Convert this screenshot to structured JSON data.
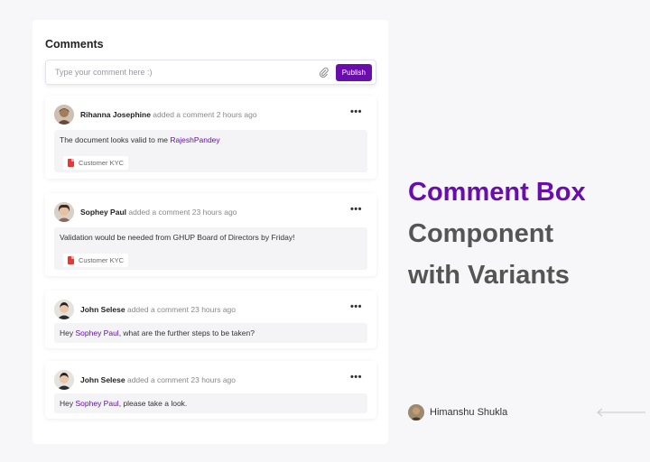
{
  "comments_section": {
    "title": "Comments",
    "composer": {
      "placeholder": "Type your comment here :)",
      "value": "",
      "publish_label": "Publish"
    }
  },
  "comments": [
    {
      "author": "Rihanna Josephine",
      "action": " added a comment 2 hours ago",
      "text_before": "The document looks valid to me ",
      "mention": "RajeshPandey",
      "text_after": "",
      "attachment": "Customer KYC",
      "more_label": "•••"
    },
    {
      "author": "Sophey Paul",
      "action": " added a comment 23 hours ago",
      "text_before": "Validation would be needed from GHUP Board of Directors by Friday!",
      "mention": "",
      "text_after": "",
      "attachment": "Customer KYC",
      "more_label": "•••"
    },
    {
      "author": "John Selese",
      "action": " added a comment 23 hours ago",
      "text_before": "Hey ",
      "mention": "Sophey Paul",
      "text_after": ", what are the further steps to be taken?",
      "more_label": "•••"
    },
    {
      "author": "John Selese",
      "action": " added a comment 23 hours ago",
      "text_before": "Hey ",
      "mention": "Sophey Paul",
      "text_after": ", please take a look.",
      "more_label": "•••"
    }
  ],
  "headline": {
    "line1": "Comment Box",
    "line2": "Component",
    "line3": "with Variants"
  },
  "credit": {
    "name": "Himanshu Shukla"
  },
  "colors": {
    "accent": "#6a0dad",
    "heading_gray": "#555555",
    "pdf_red": "#e53935"
  }
}
